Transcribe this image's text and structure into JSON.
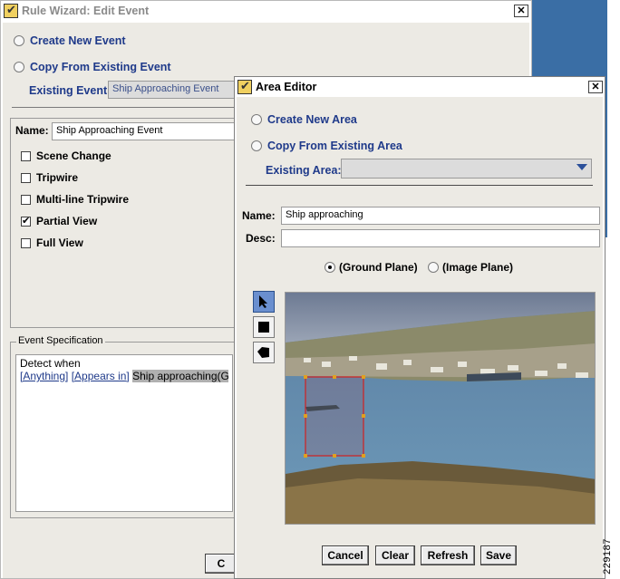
{
  "rule_wizard": {
    "title": "Rule Wizard: Edit Event",
    "create_new_event": "Create New Event",
    "copy_from_existing_event": "Copy From Existing Event",
    "existing_event_label": "Existing Event:",
    "existing_event_value": "Ship Approaching Event",
    "name_label": "Name:",
    "name_value": "Ship Approaching Event",
    "checkboxes": [
      {
        "label": "Scene Change",
        "checked": false
      },
      {
        "label": "Tripwire",
        "checked": false
      },
      {
        "label": "Multi-line Tripwire",
        "checked": false
      },
      {
        "label": "Partial View",
        "checked": true
      },
      {
        "label": "Full View",
        "checked": false
      }
    ],
    "event_spec_label": "Event Specification",
    "spec_line1": "Detect when",
    "spec_token1": "[Anything]",
    "spec_token2": "[Appears in]",
    "spec_highlight": "Ship approaching(G",
    "partial_button": "C"
  },
  "area_editor": {
    "title": "Area Editor",
    "create_new_area": "Create New Area",
    "copy_from_existing_area": "Copy From Existing Area",
    "existing_area_label": "Existing Area:",
    "existing_area_value": "",
    "name_label": "Name:",
    "name_value": "Ship approaching",
    "desc_label": "Desc:",
    "desc_value": "",
    "ground_plane": "(Ground Plane)",
    "image_plane": "(Image Plane)",
    "selected_plane": "ground",
    "tools": [
      "pointer-tool",
      "rectangle-tool",
      "polygon-tool"
    ],
    "buttons": {
      "cancel": "Cancel",
      "clear": "Clear",
      "refresh": "Refresh",
      "save": "Save"
    }
  },
  "side_code": "229187",
  "colors": {
    "desktop_blue": "#3a6ea5",
    "selection_red": "#d02020",
    "link_blue": "#1f3a8a"
  }
}
